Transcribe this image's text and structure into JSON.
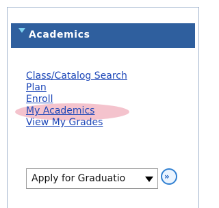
{
  "panel": {
    "title": "Academics",
    "links": [
      {
        "label": "Class/Catalog Search"
      },
      {
        "label": "Plan"
      },
      {
        "label": "Enroll"
      },
      {
        "label": "My Academics",
        "highlighted": true
      },
      {
        "label": "View My Grades"
      }
    ],
    "select": {
      "value": "Apply for Graduatio"
    },
    "go_button": {
      "icon": "double-chevron-right-icon",
      "glyph": "»"
    },
    "colors": {
      "header_bg": "#2f5f9e",
      "header_arrow": "#7ed1f0",
      "link": "#1d47b8",
      "highlight": "#f2b8c4"
    }
  }
}
